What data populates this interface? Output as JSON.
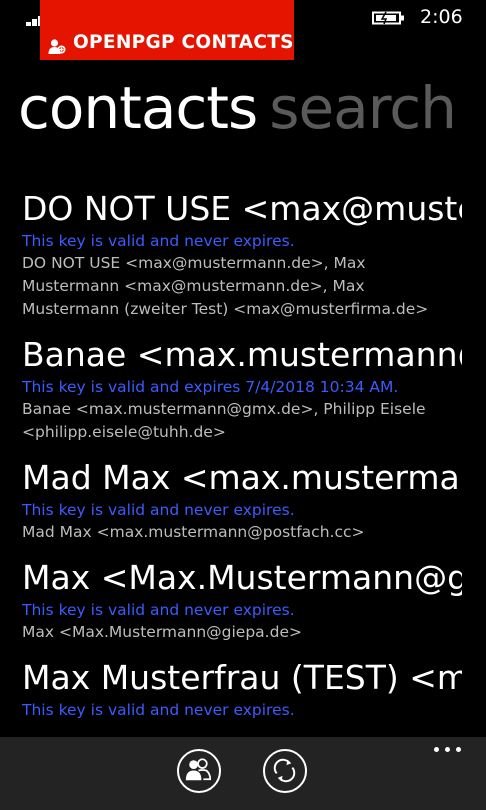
{
  "status_bar": {
    "time": "2:06",
    "signal_icon": "signal-icon",
    "battery_icon": "battery-charging-icon"
  },
  "app": {
    "title": "OPENPGP CONTACTS",
    "accent": "#e51400"
  },
  "pivot": {
    "active": "contacts",
    "inactive": "search"
  },
  "contacts": [
    {
      "name": "DO NOT USE <max@mustermann.de>",
      "validity": "This key is valid and never expires.",
      "uids": "DO NOT USE <max@mustermann.de>, Max Mustermann <max@mustermann.de>, Max Mustermann (zweiter Test) <max@musterfirma.de>"
    },
    {
      "name": "Banae <max.mustermann@gmx.de>",
      "validity": "This key is valid and expires 7/4/2018 10:34 AM.",
      "uids": "Banae <max.mustermann@gmx.de>, Philipp Eisele <philipp.eisele@tuhh.de>"
    },
    {
      "name": "Mad Max <max.mustermann@postfach.cc>",
      "validity": "This key is valid and never expires.",
      "uids": "Mad Max <max.mustermann@postfach.cc>"
    },
    {
      "name": "Max <Max.Mustermann@giepa.de>",
      "validity": "This key is valid and never expires.",
      "uids": "Max <Max.Mustermann@giepa.de>"
    },
    {
      "name": "Max Musterfrau (TEST) <max",
      "validity": "This key is valid and never expires.",
      "uids": ""
    }
  ],
  "app_bar": {
    "contacts_button_icon": "people-icon",
    "sync_button_icon": "sync-icon",
    "more_icon": "more-icon"
  },
  "colors": {
    "validity": "#3a5cff",
    "uids": "#bdbdbd",
    "appbar": "#232323",
    "inactive_pivot": "#5a5a5a"
  }
}
